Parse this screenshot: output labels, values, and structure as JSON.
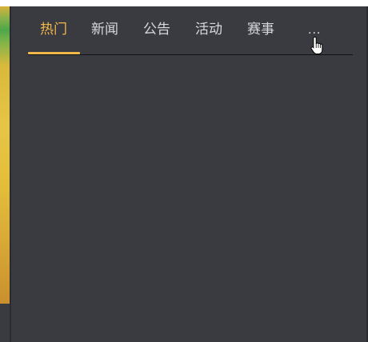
{
  "tabs": [
    {
      "label": "热门",
      "active": true
    },
    {
      "label": "新闻",
      "active": false
    },
    {
      "label": "公告",
      "active": false
    },
    {
      "label": "活动",
      "active": false
    },
    {
      "label": "赛事",
      "active": false
    }
  ],
  "more_label": "...",
  "colors": {
    "background": "#3a3b40",
    "active_tab": "#f2b84a",
    "inactive_tab": "#d8d8dc"
  },
  "icons": {
    "cursor": "hand-pointer-icon"
  }
}
